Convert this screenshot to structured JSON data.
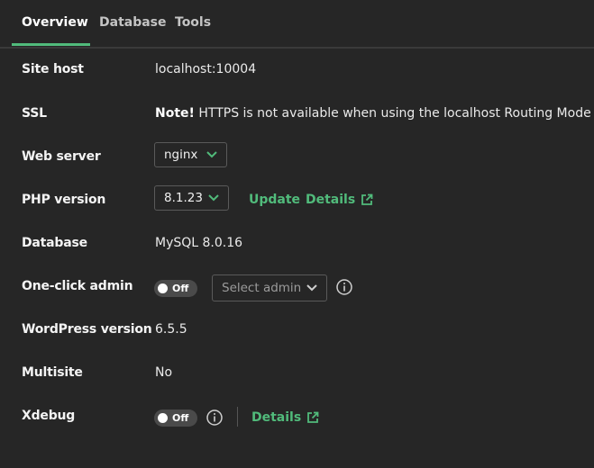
{
  "tabs": [
    "Overview",
    "Database",
    "Tools"
  ],
  "rows": {
    "site_host": {
      "label": "Site host",
      "value": "localhost:10004"
    },
    "ssl": {
      "label": "SSL",
      "note": "Note!",
      "text": " HTTPS is not available when using the localhost Routing Mode"
    },
    "web_server": {
      "label": "Web server",
      "selected": "nginx"
    },
    "php": {
      "label": "PHP version",
      "selected": "8.1.23",
      "update": "Update",
      "details": "Details"
    },
    "database": {
      "label": "Database",
      "value": "MySQL 8.0.16"
    },
    "admin": {
      "label": "One-click admin",
      "toggle": "Off",
      "placeholder": "Select admin"
    },
    "wp": {
      "label": "WordPress version",
      "value": "6.5.5"
    },
    "multisite": {
      "label": "Multisite",
      "value": "No"
    },
    "xdebug": {
      "label": "Xdebug",
      "toggle": "Off",
      "details": "Details"
    }
  },
  "colors": {
    "accent": "#51bb7b",
    "background": "#262626"
  }
}
